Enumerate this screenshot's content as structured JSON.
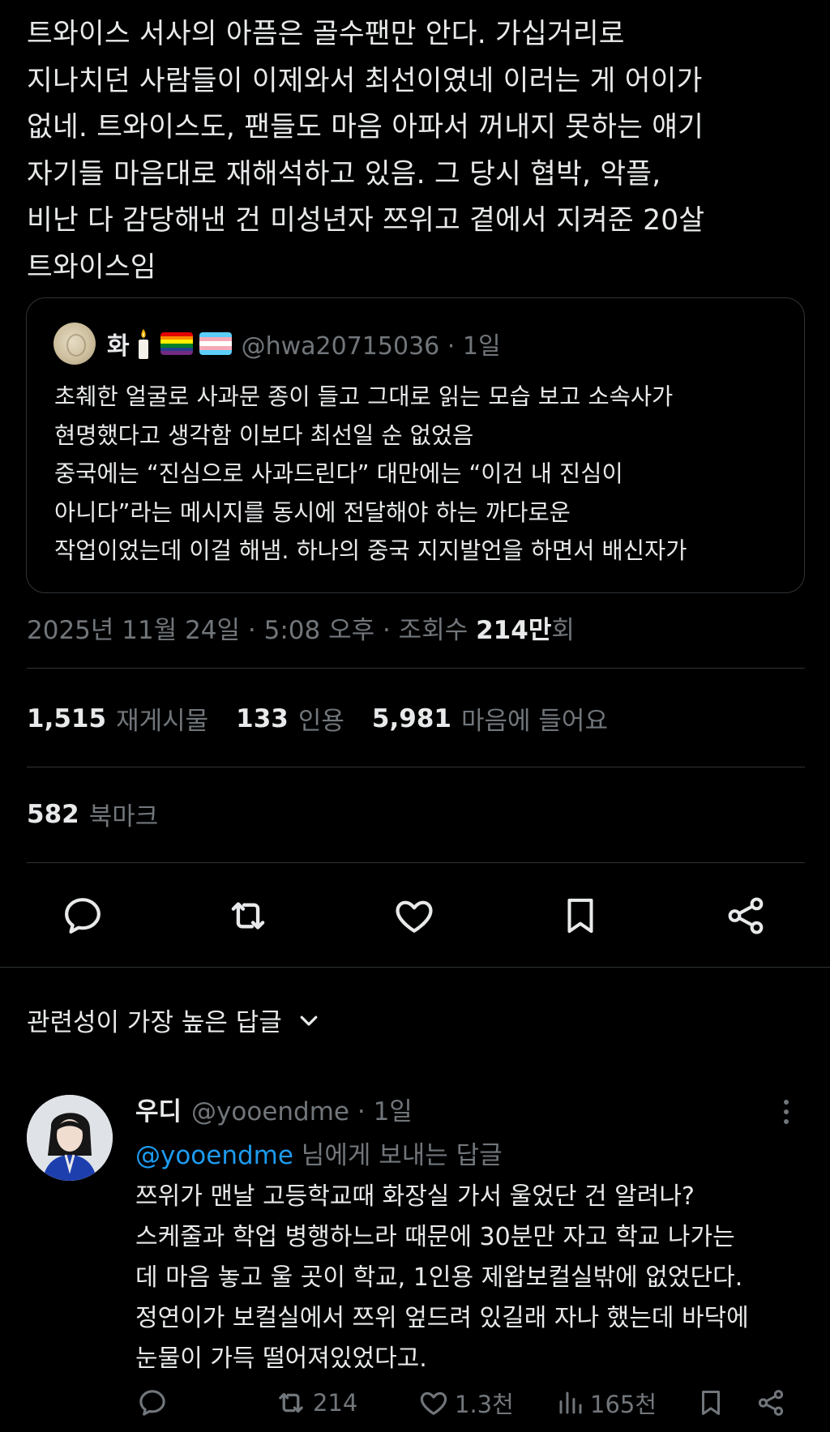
{
  "post": {
    "text": "트와이스 서사의 아픔은 골수팬만 안다. 가십거리로\n지나치던 사람들이 이제와서 최선이였네 이러는 게 어이가\n없네. 트와이스도, 팬들도 마음 아파서 꺼내지 못하는 얘기\n자기들 마음대로 재해석하고 있음. 그 당시 협박, 악플,\n비난 다 감당해낸 건 미성년자 쯔위고 곁에서 지켜준 20살\n트와이스임"
  },
  "quote": {
    "name": "화",
    "handle": "@hwa20715036",
    "time": "· 1일",
    "text": "초췌한 얼굴로 사과문 종이 들고 그대로 읽는 모습 보고 소속사가\n현명했다고 생각함 이보다 최선일 순 없었음\n중국에는 “진심으로 사과드린다” 대만에는 “이건 내 진심이\n아니다”라는 메시지를 동시에 전달해야 하는 까다로운\n작업이었는데 이걸 해냄. 하나의 중국 지지발언을 하면서 배신자가"
  },
  "meta": {
    "date_time": "2025년 11월 24일 · 5:08 오후 · 조회수 ",
    "views": "214만",
    "views_unit": "회"
  },
  "stats": {
    "reposts": "1,515",
    "reposts_label": "재게시물",
    "quotes": "133",
    "quotes_label": "인용",
    "likes": "5,981",
    "likes_label": "마음에 들어요",
    "bookmarks": "582",
    "bookmarks_label": "북마크"
  },
  "actions": {
    "icons": [
      "reply-icon",
      "repost-icon",
      "like-icon",
      "bookmark-icon",
      "share-icon"
    ]
  },
  "replies_header": {
    "label": "관련성이 가장 높은 답글"
  },
  "reply": {
    "name": "우디",
    "handle": "@yooendme",
    "time": "· 1일",
    "replying_mention": "@yooendme",
    "replying_suffix": " 님에게 보내는 답글",
    "text": "쯔위가 맨날 고등학교때 화장실 가서 울었단 건 알려나?\n스케줄과 학업 병행하느라 때문에 30분만 자고 학교 나가는\n데 마음 놓고 울 곳이 학교, 1인용 제왑보컬실밖에 없었단다.\n정연이가 보컬실에서 쯔위 엎드려 있길래 자나 했는데 바닥에\n눈물이 가득 떨어져있었다고.",
    "repost_count": "214",
    "like_count": "1.3천",
    "view_count": "165천"
  },
  "colors": {
    "background": "#000000",
    "text": "#e7e9ea",
    "muted": "#71767b",
    "border": "#2f3336",
    "link": "#1d9bf0"
  }
}
